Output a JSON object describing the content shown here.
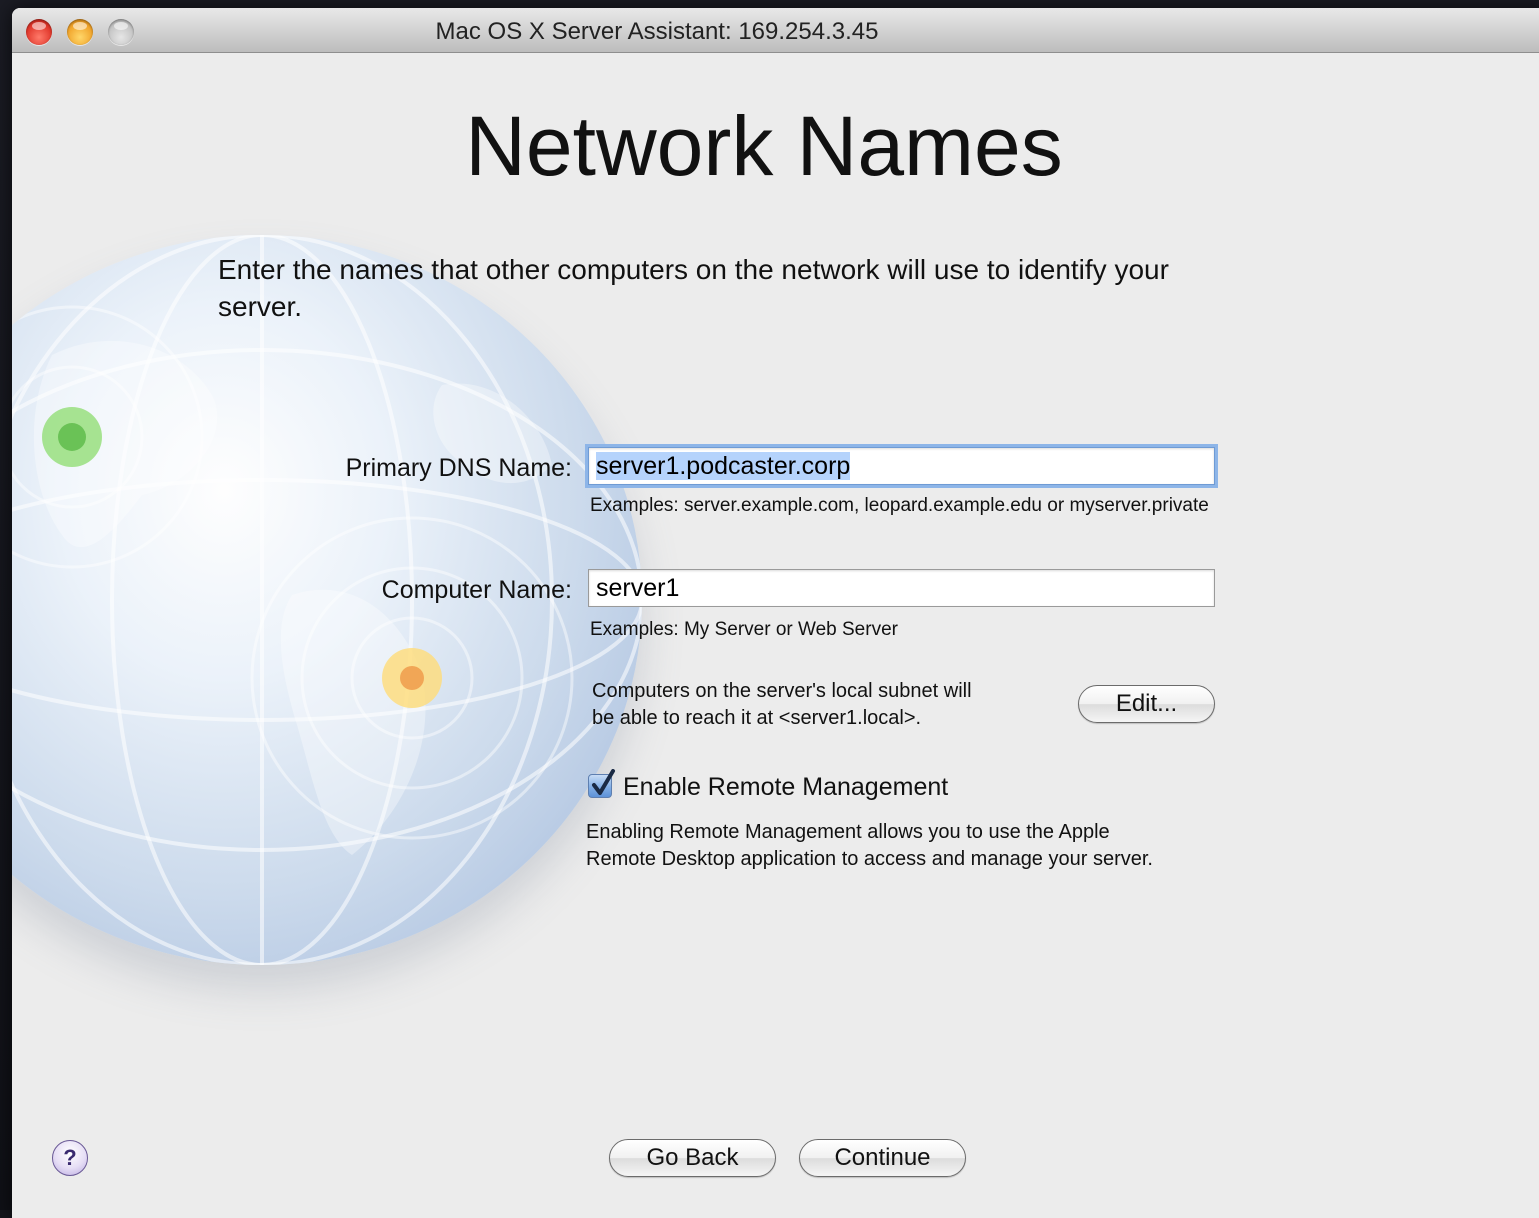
{
  "window": {
    "title": "Mac OS X Server Assistant: 169.254.3.45"
  },
  "page": {
    "title": "Network Names",
    "intro_line1": "Enter the names that other computers on the network will use to identify your",
    "intro_line2": "server."
  },
  "primary_dns": {
    "label": "Primary DNS Name:",
    "value": "server1.podcaster.corp",
    "hint": "Examples: server.example.com, leopard.example.edu or myserver.private"
  },
  "computer_name": {
    "label": "Computer Name:",
    "value": "server1",
    "hint": "Examples: My Server or Web Server"
  },
  "local_subnet": {
    "line1": "Computers on the server's local subnet will",
    "line2": "be able to reach it at <server1.local>.",
    "edit_label": "Edit..."
  },
  "remote_management": {
    "label": "Enable Remote Management",
    "checked": true,
    "desc_line1": "Enabling Remote Management allows you to use the Apple",
    "desc_line2": "Remote Desktop application to access and manage your server."
  },
  "footer": {
    "help_symbol": "?",
    "back_label": "Go Back",
    "continue_label": "Continue"
  },
  "colors": {
    "focus_ring": "#8db5e8",
    "selection": "#b5d3fc",
    "checkbox": "#5d92d8"
  }
}
